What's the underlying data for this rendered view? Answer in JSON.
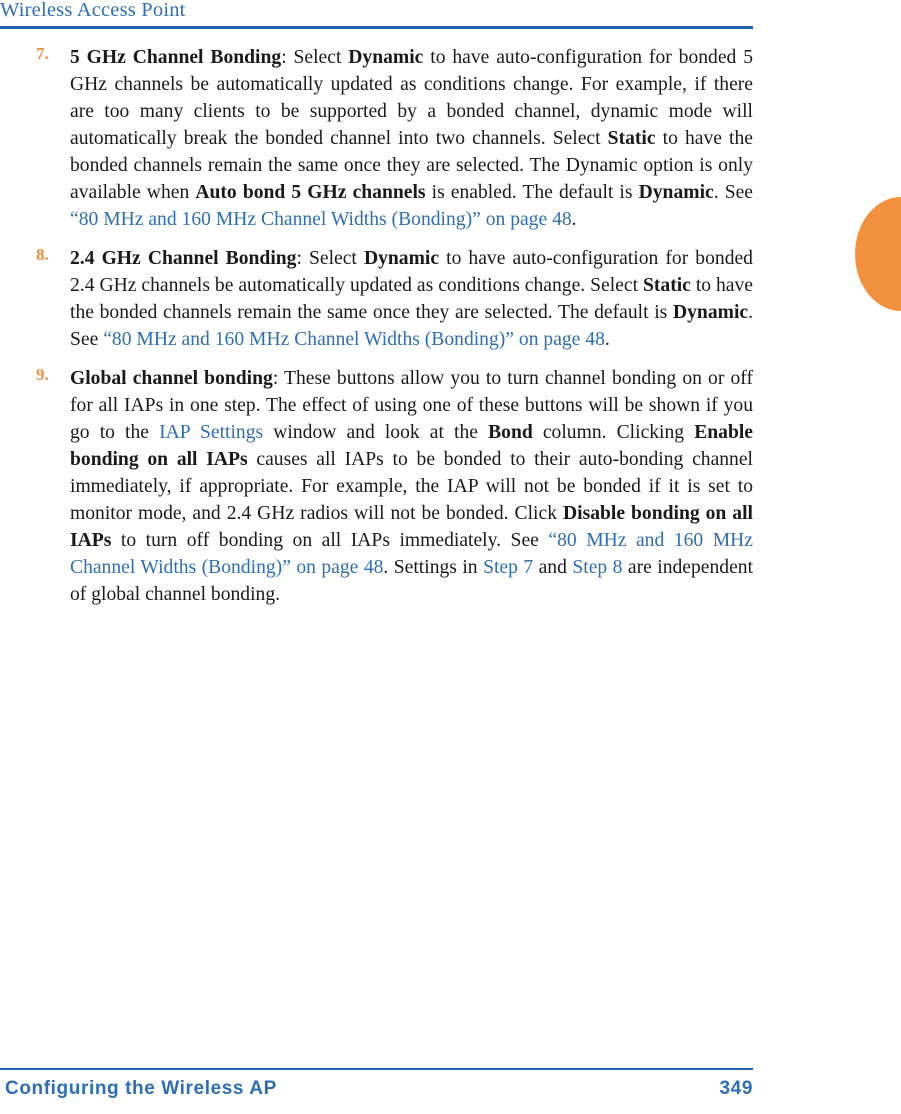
{
  "header": {
    "title": "Wireless Access Point"
  },
  "colors": {
    "link_blue": "#2E6EB5",
    "rule_blue": "#1F63AC",
    "marker_orange": "#F2913D",
    "body_text": "#1a1a1a",
    "page_background": "#ffffff"
  },
  "chapter_tab": {
    "shape": "half-circle",
    "color": "#F2913D"
  },
  "steps": [
    {
      "number": "7.",
      "term": "5 GHz Channel Bonding",
      "text_after_term": ": Select ",
      "b1": "Dynamic",
      "t1": " to have auto-configuration for bonded 5 GHz channels be automatically updated as conditions change. For example, if there are too many clients to be supported by a bonded channel, dynamic mode will automatically break the bonded channel into two channels. Select ",
      "b2": "Static",
      "t2": " to have the bonded channels remain the same once they are selected. The Dynamic option is only available when ",
      "b3": "Auto bond 5 GHz channels",
      "t3": " is enabled. The default is ",
      "b4": "Dynamic",
      "t4": ". See ",
      "link1": "“80 MHz and 160 MHz Channel Widths (Bonding)” on page 48",
      "t5": "."
    },
    {
      "number": "8.",
      "term": "2.4 GHz Channel Bonding",
      "text_after_term": ": Select ",
      "b1": "Dynamic",
      "t1": " to have auto-configuration for bonded 2.4 GHz channels be automatically updated as conditions change. Select ",
      "b2": "Static",
      "t2": " to have the bonded channels remain the same once they are selected. The default is ",
      "b3": "Dynamic",
      "t3": ". See ",
      "link1": "“80 MHz and 160 MHz Channel Widths (Bonding)” on page 48",
      "t4": "."
    },
    {
      "number": "9.",
      "term": "Global channel bonding",
      "text_after_term": ": These buttons allow you to turn channel bonding on or off for all IAPs in one step. The effect of using one of these buttons will be shown if you go to the ",
      "link1": "IAP Settings",
      "t1": " window and look at the ",
      "b1": "Bond",
      "t2": " column. Clicking ",
      "b2": "Enable bonding on all IAPs",
      "t3": " causes all IAPs to be bonded to their auto-bonding channel immediately, if appropriate. For example, the IAP will not be bonded if it is set to monitor mode, and 2.4 GHz radios will not be bonded. Click ",
      "b3": "Disable bonding on all IAPs",
      "t4": " to turn off bonding on all IAPs immediately. See ",
      "link2": "“80 MHz and 160 MHz Channel Widths (Bonding)” on page 48",
      "t5": ". Settings in ",
      "link3": "Step 7",
      "t6": " and ",
      "link4": "Step 8",
      "t7": " are independent of global channel bonding."
    }
  ],
  "footer": {
    "title": "Configuring the Wireless AP",
    "page_number": "349"
  }
}
